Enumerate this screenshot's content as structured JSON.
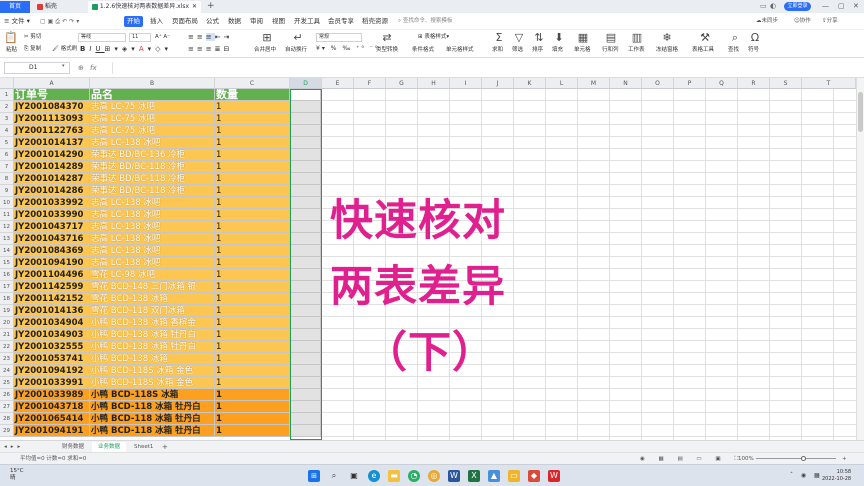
{
  "tabbar": {
    "home": "首页",
    "docer": "稻壳",
    "file": "1.2.6快速核对两表数据差异.xlsx",
    "login": "立即登录"
  },
  "menubar": {
    "file": "文件",
    "items": [
      "开始",
      "插入",
      "页面布局",
      "公式",
      "数据",
      "审阅",
      "视图",
      "开发工具",
      "会员专享",
      "稻壳资源"
    ],
    "search": "查找命令、搜索模板",
    "right": [
      "未同步",
      "协作",
      "分享"
    ]
  },
  "ribbon": {
    "paste": "粘贴",
    "cut": "剪切",
    "copy": "复制",
    "format_painter": "格式刷",
    "font_name": "等线",
    "font_size": "11",
    "merge": "合并居中",
    "wrap": "自动换行",
    "number_format": "常规",
    "type_convert": "类型转换",
    "table_style": "表格样式",
    "cond_format": "条件格式",
    "cell_style": "单元格样式",
    "sum": "求和",
    "filter": "筛选",
    "sort": "排序",
    "fill": "填充",
    "cell": "单元格",
    "row_col": "行和列",
    "worksheet": "工作表",
    "freeze": "冻结窗格",
    "table_tools": "表格工具",
    "find": "查找",
    "symbol": "符号"
  },
  "formula_bar": {
    "name_box": "D1",
    "fx": "fx"
  },
  "columns": [
    "A",
    "B",
    "C",
    "D",
    "E",
    "F",
    "G",
    "H",
    "I",
    "J",
    "K",
    "L",
    "M",
    "N",
    "O",
    "P",
    "Q",
    "R",
    "S",
    "T"
  ],
  "header_row": {
    "order": "订单号",
    "product": "品名",
    "qty": "数量"
  },
  "rows": [
    {
      "n": "2",
      "order": "JY2001084370",
      "product": "志高 LC-75 冰吧",
      "qty": "1",
      "hl": false
    },
    {
      "n": "3",
      "order": "JY2001113093",
      "product": "志高 LC-75 冰吧",
      "qty": "1",
      "hl": false
    },
    {
      "n": "4",
      "order": "JY2001122763",
      "product": "志高 LC-75 冰吧",
      "qty": "1",
      "hl": false
    },
    {
      "n": "5",
      "order": "JY2001014137",
      "product": "志高 LC-138 冰吧",
      "qty": "1",
      "hl": false
    },
    {
      "n": "6",
      "order": "JY2001014290",
      "product": "荣事达 BD/BC-136 冷柜",
      "qty": "1",
      "hl": false
    },
    {
      "n": "7",
      "order": "JY2001014289",
      "product": "荣事达 BD/BC-118 冷柜",
      "qty": "1",
      "hl": false
    },
    {
      "n": "8",
      "order": "JY2001014287",
      "product": "荣事达 BD/BC-118 冷柜",
      "qty": "1",
      "hl": false
    },
    {
      "n": "9",
      "order": "JY2001014286",
      "product": "荣事达 BD/BC-118 冷柜",
      "qty": "1",
      "hl": false
    },
    {
      "n": "10",
      "order": "JY2001033992",
      "product": "志高 LC-138 冰吧",
      "qty": "1",
      "hl": false
    },
    {
      "n": "11",
      "order": "JY2001033990",
      "product": "志高 LC-138 冰吧",
      "qty": "1",
      "hl": false
    },
    {
      "n": "12",
      "order": "JY2001043717",
      "product": "志高 LC-138 冰吧",
      "qty": "1",
      "hl": false
    },
    {
      "n": "13",
      "order": "JY2001043716",
      "product": "志高 LC-138 冰吧",
      "qty": "1",
      "hl": false
    },
    {
      "n": "14",
      "order": "JY2001084369",
      "product": "志高 LC-138 冰吧",
      "qty": "1",
      "hl": false
    },
    {
      "n": "15",
      "order": "JY2001094190",
      "product": "志高 LC-138 冰吧",
      "qty": "1",
      "hl": false
    },
    {
      "n": "16",
      "order": "JY2001104496",
      "product": "雪花 LC-98 冰吧",
      "qty": "1",
      "hl": false
    },
    {
      "n": "17",
      "order": "JY2001142599",
      "product": "雪花 BCD-148 三门冰箱 银",
      "qty": "1",
      "hl": false
    },
    {
      "n": "18",
      "order": "JY2001142152",
      "product": "雪花 BCD-138 冰箱",
      "qty": "1",
      "hl": false
    },
    {
      "n": "19",
      "order": "JY2001014136",
      "product": "雪花 BCD-118 双门冰箱",
      "qty": "1",
      "hl": false
    },
    {
      "n": "20",
      "order": "JY2001034904",
      "product": "小鸭 BCD-138 冰箱 香槟金",
      "qty": "1",
      "hl": false
    },
    {
      "n": "21",
      "order": "JY2001034903",
      "product": "小鸭 BCD-138 冰箱 牡丹白",
      "qty": "1",
      "hl": false
    },
    {
      "n": "22",
      "order": "JY2001032555",
      "product": "小鸭 BCD-138 冰箱 牡丹白",
      "qty": "1",
      "hl": false
    },
    {
      "n": "23",
      "order": "JY2001053741",
      "product": "小鸭 BCD-138 冰箱",
      "qty": "1",
      "hl": false
    },
    {
      "n": "24",
      "order": "JY2001094192",
      "product": "小鸭 BCD-118S 冰箱 金色",
      "qty": "1",
      "hl": false
    },
    {
      "n": "25",
      "order": "JY2001033991",
      "product": "小鸭 BCD-118S 冰箱 金色",
      "qty": "1",
      "hl": false
    },
    {
      "n": "26",
      "order": "JY2001033989",
      "product": "小鸭 BCD-118S 冰箱",
      "qty": "1",
      "hl": true
    },
    {
      "n": "27",
      "order": "JY2001043718",
      "product": "小鸭 BCD-118 冰箱 牡丹白",
      "qty": "1",
      "hl": true
    },
    {
      "n": "28",
      "order": "JY2001065414",
      "product": "小鸭 BCD-118 冰箱 牡丹白",
      "qty": "1",
      "hl": true
    },
    {
      "n": "29",
      "order": "JY2001094191",
      "product": "小鸭 BCD-118 冰箱 牡丹白",
      "qty": "1",
      "hl": true
    }
  ],
  "overlay": {
    "line1": "快速核对",
    "line2": "两表差异",
    "line3": "（下）"
  },
  "sheets": {
    "tabs": [
      "财务数据",
      "业务数据",
      "Sheet1"
    ],
    "active_index": 1
  },
  "status": {
    "summary": "平均值=0  计数=0  求和=0",
    "zoom": "100%"
  },
  "taskbar": {
    "weather_temp": "15°C",
    "weather_desc": "晴",
    "time": "10:58",
    "date": "2022-10-28"
  },
  "colors": {
    "accent": "#2b6ef6",
    "header_green": "#62b04e",
    "cell_yellow": "#fdc651",
    "cell_orange": "#fda020",
    "overlay_pink": "#e0208f",
    "selection": "#1e9e5a"
  }
}
